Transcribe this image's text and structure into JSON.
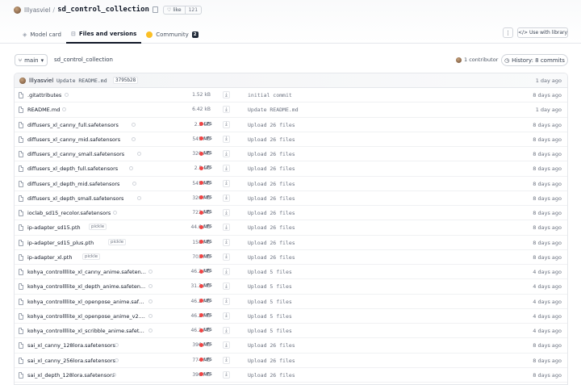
{
  "repo": {
    "owner": "lllyasviel",
    "name": "sd_control_collection",
    "like_label": "like",
    "like_count": "121"
  },
  "tabs": [
    {
      "label": "Model card",
      "icon": "model-card-icon"
    },
    {
      "label": "Files and versions",
      "icon": "files-icon"
    },
    {
      "label": "Community",
      "icon": "community-icon",
      "badge": "2"
    }
  ],
  "toolbar": {
    "menu_label": "⋮",
    "use_library_label": "Use with library"
  },
  "branch": {
    "name": "main",
    "breadcrumb": "sd_control_collection",
    "contributors": "1 contributor",
    "history": "History: 8 commits"
  },
  "last_commit": {
    "author": "lllyasviel",
    "message": "Update README.md",
    "sha": "3795b28",
    "when": "1 day ago"
  },
  "files": [
    {
      "name": ".gitattributes",
      "size": "1.52 kB",
      "lfs": false,
      "pickle": false,
      "commit": "initial commit",
      "when": "8 days ago"
    },
    {
      "name": "README.md",
      "size": "6.42 kB",
      "lfs": false,
      "pickle": false,
      "commit": "Update README.md",
      "when": "1 day ago"
    },
    {
      "name": "diffusers_xl_canny_full.safetensors",
      "size": "2.5 GB",
      "lfs": true,
      "pickle": false,
      "commit": "Upload 26 files",
      "when": "8 days ago"
    },
    {
      "name": "diffusers_xl_canny_mid.safetensors",
      "size": "545 MB",
      "lfs": true,
      "pickle": false,
      "commit": "Upload 26 files",
      "when": "8 days ago"
    },
    {
      "name": "diffusers_xl_canny_small.safetensors",
      "size": "320 MB",
      "lfs": true,
      "pickle": false,
      "commit": "Upload 26 files",
      "when": "8 days ago"
    },
    {
      "name": "diffusers_xl_depth_full.safetensors",
      "size": "2.5 GB",
      "lfs": true,
      "pickle": false,
      "commit": "Upload 26 files",
      "when": "8 days ago"
    },
    {
      "name": "diffusers_xl_depth_mid.safetensors",
      "size": "545 MB",
      "lfs": true,
      "pickle": false,
      "commit": "Upload 26 files",
      "when": "8 days ago"
    },
    {
      "name": "diffusers_xl_depth_small.safetensors",
      "size": "320 MB",
      "lfs": true,
      "pickle": false,
      "commit": "Upload 26 files",
      "when": "8 days ago"
    },
    {
      "name": "ioclab_sd15_recolor.safetensors",
      "size": "723 MB",
      "lfs": true,
      "pickle": false,
      "commit": "Upload 26 files",
      "when": "8 days ago"
    },
    {
      "name": "ip-adapter_sd15.pth",
      "size": "44.6 MB",
      "lfs": true,
      "pickle": true,
      "commit": "Upload 26 files",
      "when": "8 days ago"
    },
    {
      "name": "ip-adapter_sd15_plus.pth",
      "size": "158 MB",
      "lfs": true,
      "pickle": true,
      "commit": "Upload 26 files",
      "when": "8 days ago"
    },
    {
      "name": "ip-adapter_xl.pth",
      "size": "703 MB",
      "lfs": true,
      "pickle": true,
      "commit": "Upload 26 files",
      "when": "8 days ago"
    },
    {
      "name": "kohya_controllllite_xl_canny_anime.safeten...",
      "size": "46.2 MB",
      "lfs": true,
      "pickle": false,
      "commit": "Upload 5 files",
      "when": "4 days ago"
    },
    {
      "name": "kohya_controllllite_xl_depth_anime.safeten...",
      "size": "31.3 MB",
      "lfs": true,
      "pickle": false,
      "commit": "Upload 5 files",
      "when": "4 days ago"
    },
    {
      "name": "kohya_controllllite_xl_openpose_anime.safe...",
      "size": "46.2 MB",
      "lfs": true,
      "pickle": false,
      "commit": "Upload 5 files",
      "when": "4 days ago"
    },
    {
      "name": "kohya_controllllite_xl_openpose_anime_v2....",
      "size": "46.2 MB",
      "lfs": true,
      "pickle": false,
      "commit": "Upload 5 files",
      "when": "4 days ago"
    },
    {
      "name": "kohya_controllllite_xl_scribble_anime.safete...",
      "size": "46.2 MB",
      "lfs": true,
      "pickle": false,
      "commit": "Upload 5 files",
      "when": "4 days ago"
    },
    {
      "name": "sai_xl_canny_128lora.safetensors",
      "size": "396 MB",
      "lfs": true,
      "pickle": false,
      "commit": "Upload 26 files",
      "when": "8 days ago"
    },
    {
      "name": "sai_xl_canny_256lora.safetensors",
      "size": "774 MB",
      "lfs": true,
      "pickle": false,
      "commit": "Upload 26 files",
      "when": "8 days ago"
    },
    {
      "name": "sai_xl_depth_128lora.safetensors",
      "size": "396 MB",
      "lfs": true,
      "pickle": false,
      "commit": "Upload 26 files",
      "when": "8 days ago"
    }
  ],
  "labels": {
    "lfs": "LFS",
    "pickle": "pickle"
  }
}
